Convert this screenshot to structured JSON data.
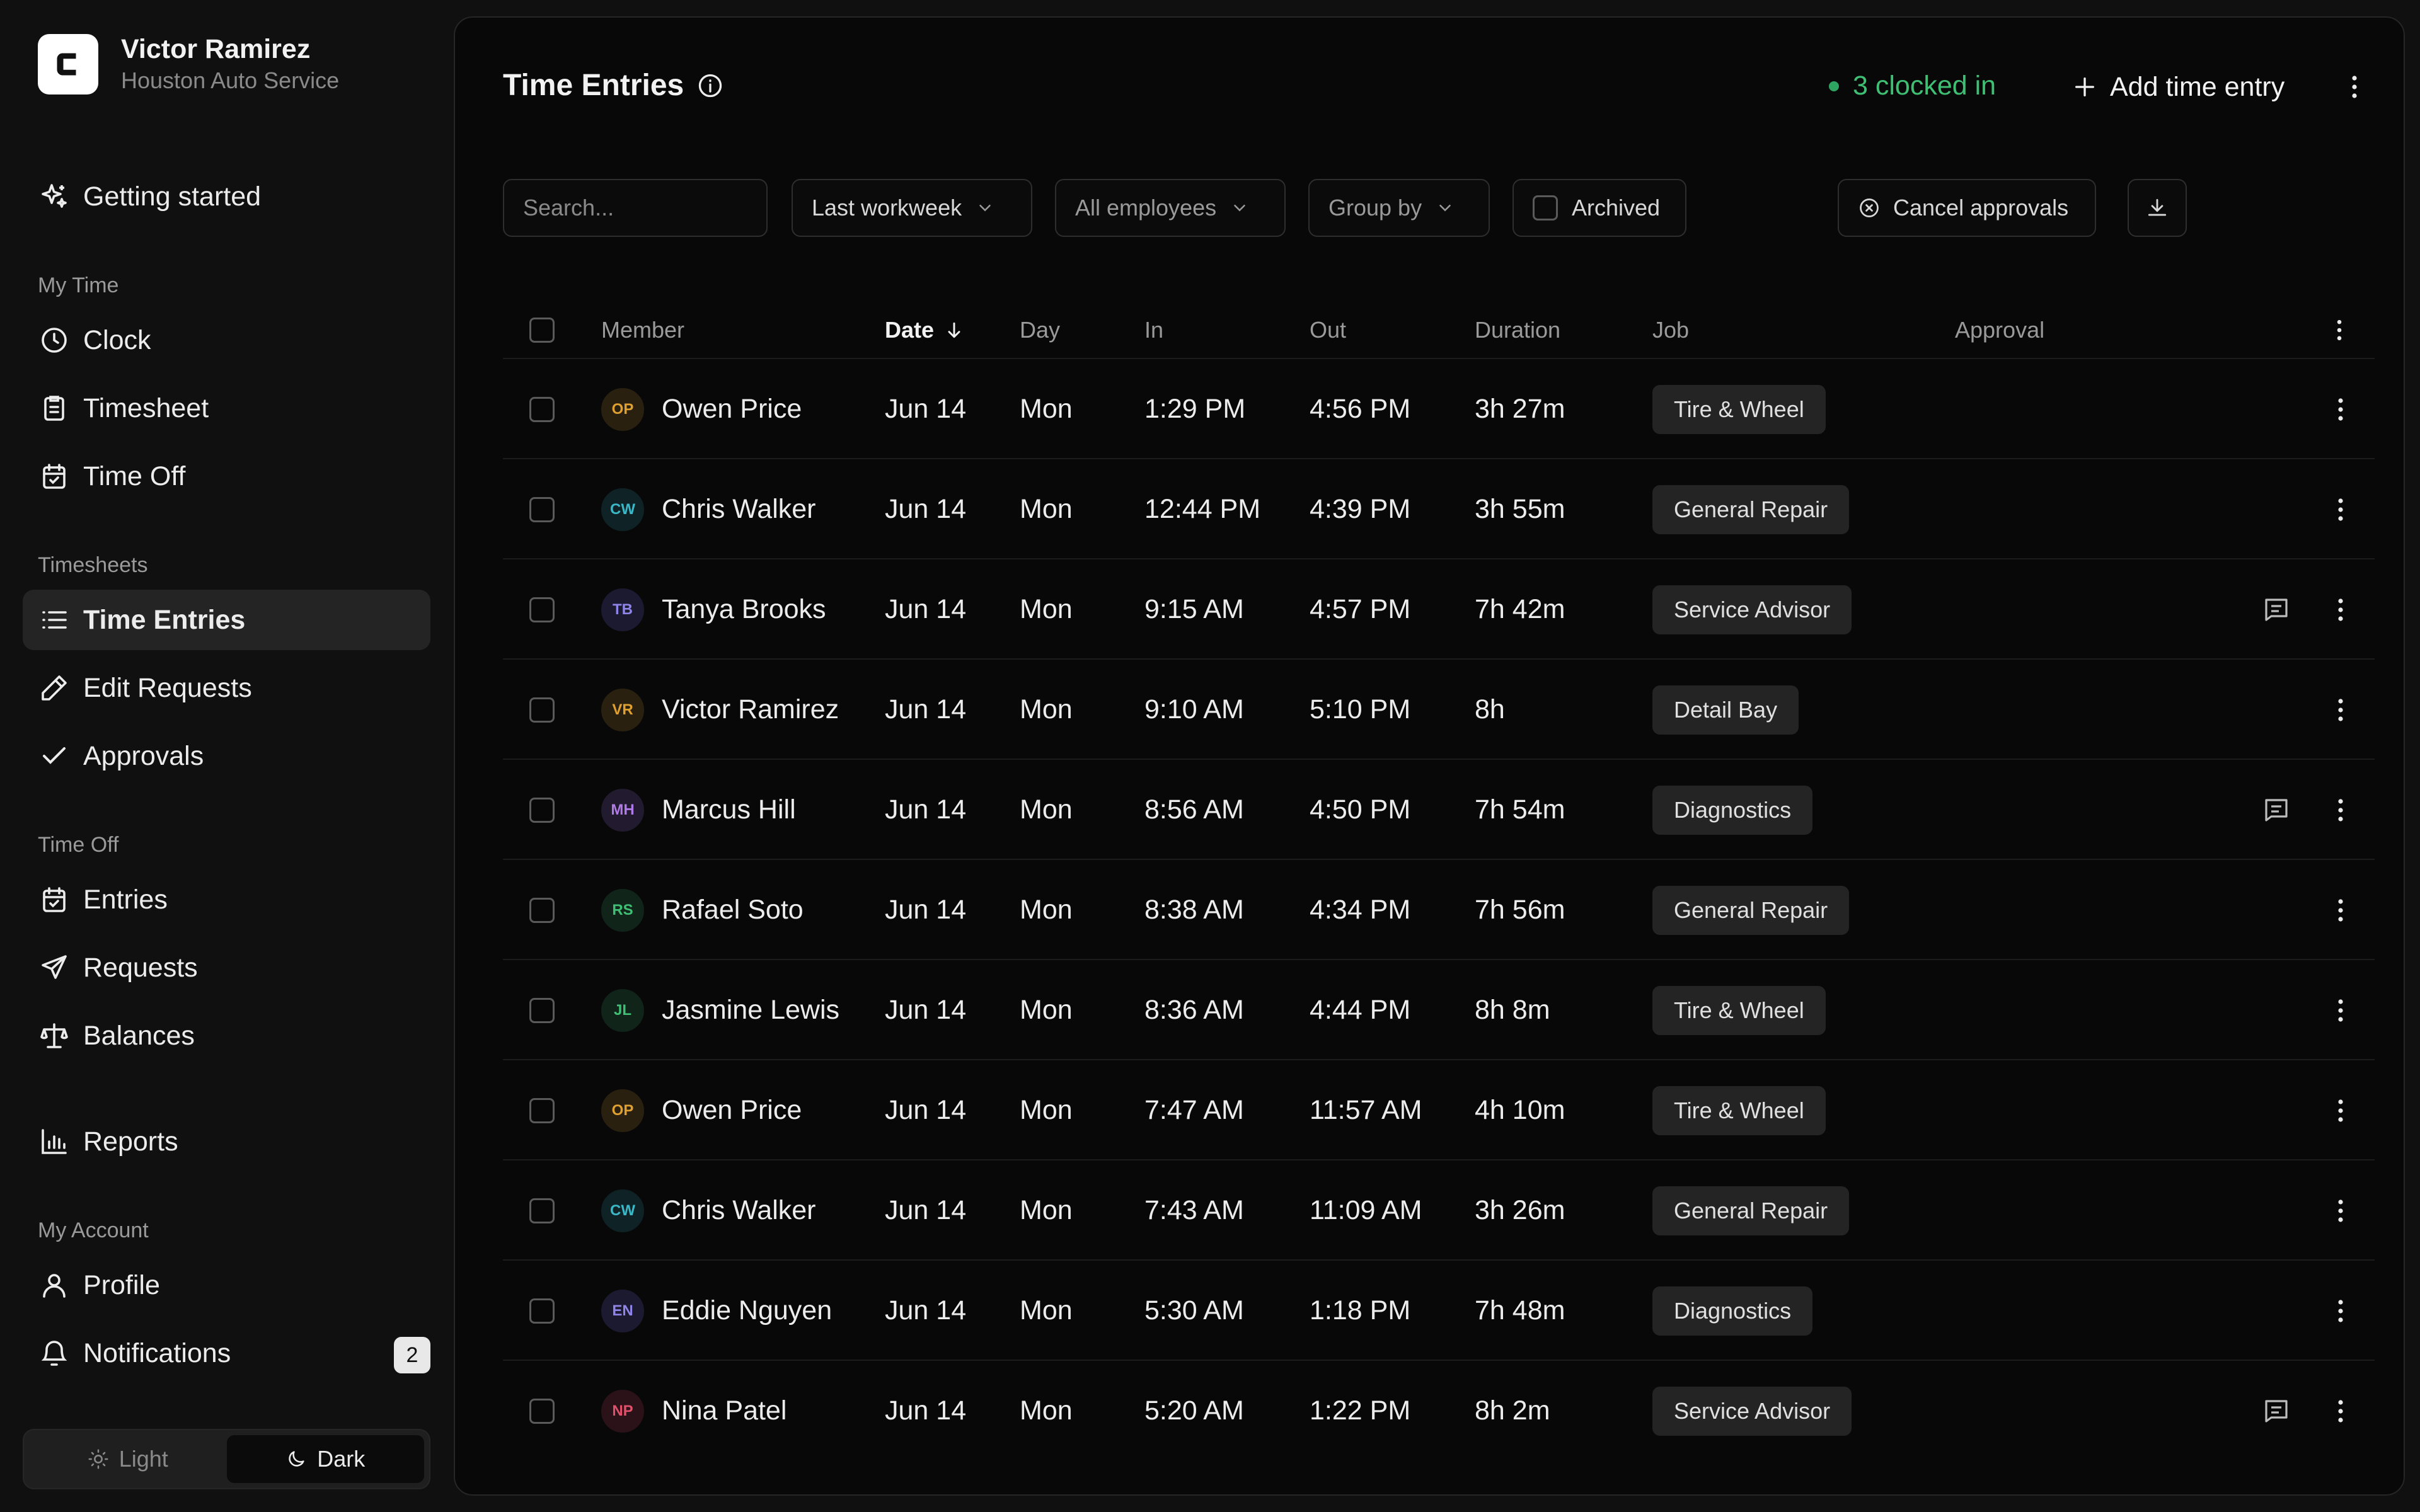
{
  "user": {
    "name": "Victor Ramirez",
    "org": "Houston Auto Service"
  },
  "sidebar": {
    "getting_started": "Getting started",
    "sections": {
      "my_time": "My Time",
      "timesheets": "Timesheets",
      "time_off": "Time Off",
      "my_account": "My Account"
    },
    "items": {
      "clock": "Clock",
      "timesheet": "Timesheet",
      "time_off": "Time Off",
      "time_entries": "Time Entries",
      "edit_requests": "Edit Requests",
      "approvals": "Approvals",
      "entries": "Entries",
      "requests": "Requests",
      "balances": "Balances",
      "reports": "Reports",
      "profile": "Profile",
      "notifications": "Notifications"
    },
    "notifications_badge": "2",
    "theme": {
      "light": "Light",
      "dark": "Dark",
      "selected": "Dark"
    }
  },
  "header": {
    "title": "Time Entries",
    "clocked_in": "3 clocked in",
    "add_entry": "Add time entry",
    "status_color": "#3fbf74"
  },
  "filters": {
    "search_placeholder": "Search...",
    "period": "Last workweek",
    "employees": "All employees",
    "group_by": "Group by",
    "archived": "Archived",
    "cancel_approvals": "Cancel approvals"
  },
  "table": {
    "columns": {
      "member": "Member",
      "date": "Date",
      "day": "Day",
      "in": "In",
      "out": "Out",
      "duration": "Duration",
      "job": "Job",
      "approval": "Approval"
    },
    "rows": [
      {
        "initials": "OP",
        "member": "Owen Price",
        "date": "Jun 14",
        "day": "Mon",
        "in": "1:29 PM",
        "out": "4:56 PM",
        "duration": "3h 27m",
        "job": "Tire & Wheel",
        "note": false,
        "avatar_color": "#e0a030",
        "avatar_bg": "#2a2010"
      },
      {
        "initials": "CW",
        "member": "Chris Walker",
        "date": "Jun 14",
        "day": "Mon",
        "in": "12:44 PM",
        "out": "4:39 PM",
        "duration": "3h 55m",
        "job": "General Repair",
        "note": false,
        "avatar_color": "#3ab8c8",
        "avatar_bg": "#0f2226"
      },
      {
        "initials": "TB",
        "member": "Tanya Brooks",
        "date": "Jun 14",
        "day": "Mon",
        "in": "9:15 AM",
        "out": "4:57 PM",
        "duration": "7h 42m",
        "job": "Service Advisor",
        "note": true,
        "avatar_color": "#8f84e8",
        "avatar_bg": "#1c1a30"
      },
      {
        "initials": "VR",
        "member": "Victor Ramirez",
        "date": "Jun 14",
        "day": "Mon",
        "in": "9:10 AM",
        "out": "5:10 PM",
        "duration": "8h",
        "job": "Detail Bay",
        "note": false,
        "avatar_color": "#e0a030",
        "avatar_bg": "#2a2010"
      },
      {
        "initials": "MH",
        "member": "Marcus Hill",
        "date": "Jun 14",
        "day": "Mon",
        "in": "8:56 AM",
        "out": "4:50 PM",
        "duration": "7h 54m",
        "job": "Diagnostics",
        "note": true,
        "avatar_color": "#b07ae8",
        "avatar_bg": "#221a2e"
      },
      {
        "initials": "RS",
        "member": "Rafael Soto",
        "date": "Jun 14",
        "day": "Mon",
        "in": "8:38 AM",
        "out": "4:34 PM",
        "duration": "7h 56m",
        "job": "General Repair",
        "note": false,
        "avatar_color": "#3fbf74",
        "avatar_bg": "#10241a"
      },
      {
        "initials": "JL",
        "member": "Jasmine Lewis",
        "date": "Jun 14",
        "day": "Mon",
        "in": "8:36 AM",
        "out": "4:44 PM",
        "duration": "8h 8m",
        "job": "Tire & Wheel",
        "note": false,
        "avatar_color": "#3fbf74",
        "avatar_bg": "#10241a"
      },
      {
        "initials": "OP",
        "member": "Owen Price",
        "date": "Jun 14",
        "day": "Mon",
        "in": "7:47 AM",
        "out": "11:57 AM",
        "duration": "4h 10m",
        "job": "Tire & Wheel",
        "note": false,
        "avatar_color": "#e0a030",
        "avatar_bg": "#2a2010"
      },
      {
        "initials": "CW",
        "member": "Chris Walker",
        "date": "Jun 14",
        "day": "Mon",
        "in": "7:43 AM",
        "out": "11:09 AM",
        "duration": "3h 26m",
        "job": "General Repair",
        "note": false,
        "avatar_color": "#3ab8c8",
        "avatar_bg": "#0f2226"
      },
      {
        "initials": "EN",
        "member": "Eddie Nguyen",
        "date": "Jun 14",
        "day": "Mon",
        "in": "5:30 AM",
        "out": "1:18 PM",
        "duration": "7h 48m",
        "job": "Diagnostics",
        "note": false,
        "avatar_color": "#8f84e8",
        "avatar_bg": "#1c1a30"
      },
      {
        "initials": "NP",
        "member": "Nina Patel",
        "date": "Jun 14",
        "day": "Mon",
        "in": "5:20 AM",
        "out": "1:22 PM",
        "duration": "8h 2m",
        "job": "Service Advisor",
        "note": true,
        "avatar_color": "#e0506a",
        "avatar_bg": "#2a1218"
      }
    ]
  }
}
